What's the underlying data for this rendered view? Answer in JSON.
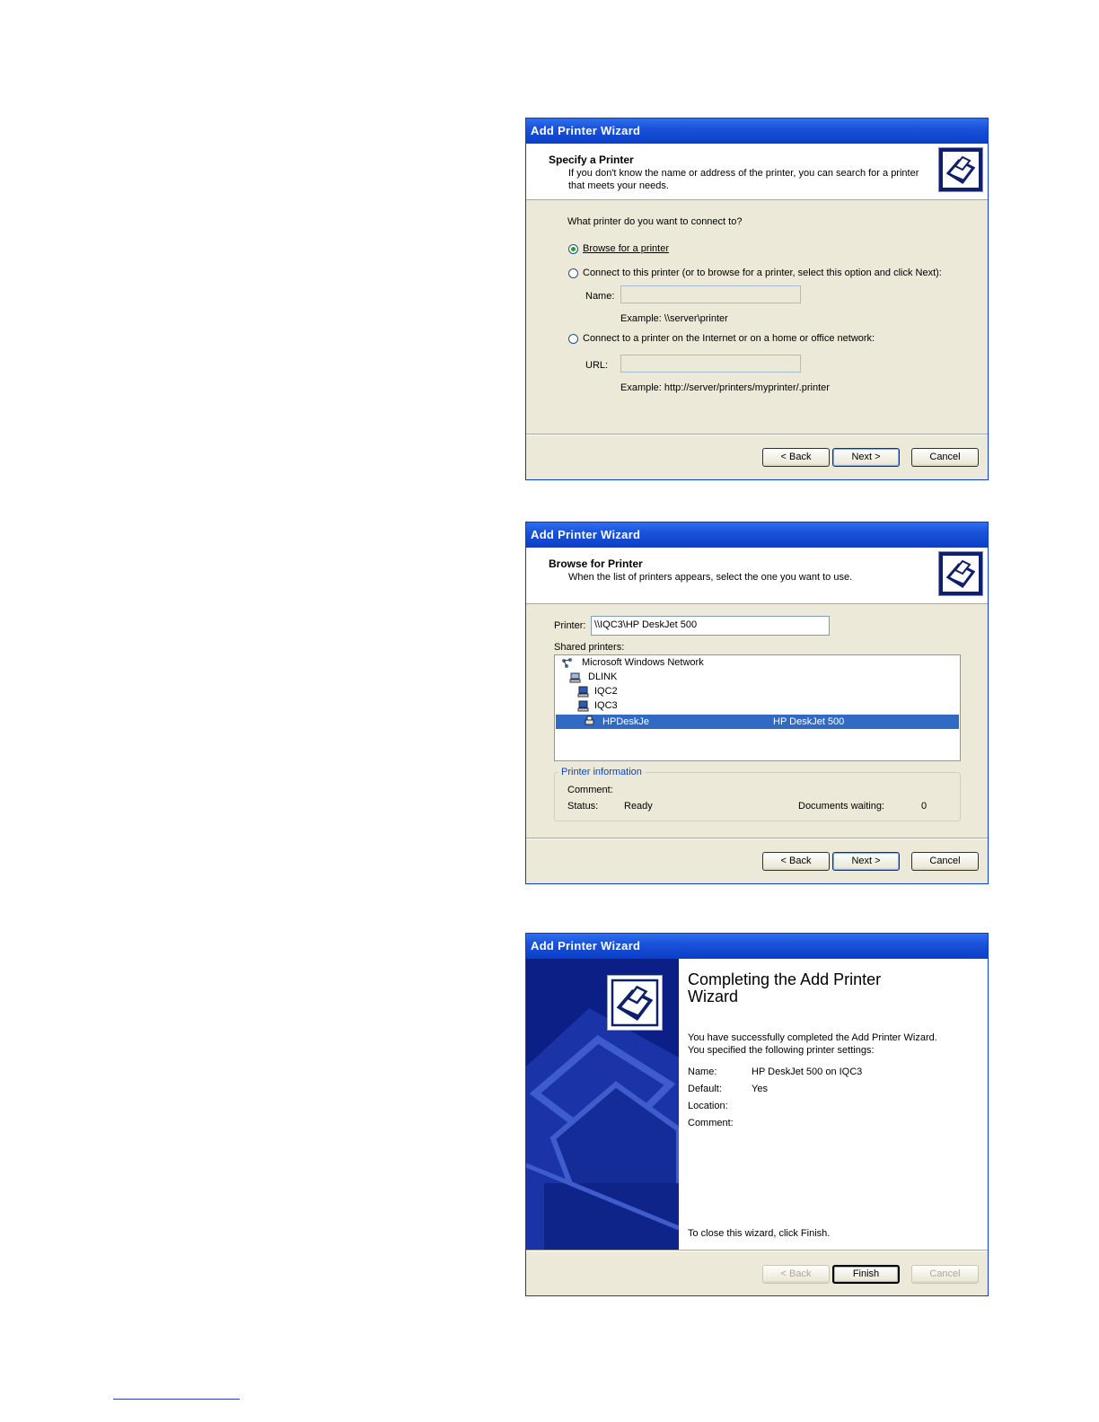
{
  "wizard1": {
    "title": "Add Printer Wizard",
    "header_title": "Specify a Printer",
    "header_desc": "If you don't know the name or address of the printer, you can search for a printer that meets your needs.",
    "question": "What printer do you want to connect to?",
    "option_browse": "Browse for a printer",
    "option_connect": "Connect to this printer (or to browse for a printer, select this option and click Next):",
    "name_label": "Name:",
    "name_value": "",
    "name_example": "Example: \\\\server\\printer",
    "option_internet": "Connect to a printer on the Internet or on a home or office network:",
    "url_label": "URL:",
    "url_value": "",
    "url_example": "Example: http://server/printers/myprinter/.printer",
    "btn_back": "< Back",
    "btn_next": "Next >",
    "btn_cancel": "Cancel"
  },
  "wizard2": {
    "title": "Add Printer Wizard",
    "header_title": "Browse for Printer",
    "header_desc": "When the list of printers appears, select the one you want to use.",
    "printer_label": "Printer:",
    "printer_value": "\\\\IQC3\\HP DeskJet 500",
    "shared_label": "Shared printers:",
    "tree": {
      "network": "Microsoft Windows Network",
      "domain": "DLINK",
      "pc1": "IQC2",
      "pc2": "IQC3",
      "printer_name": "HPDeskJe",
      "printer_model": "HP DeskJet 500"
    },
    "info_group": "Printer information",
    "comment_label": "Comment:",
    "status_label": "Status:",
    "status_value": "Ready",
    "docs_label": "Documents waiting:",
    "docs_value": "0",
    "btn_back": "< Back",
    "btn_next": "Next >",
    "btn_cancel": "Cancel"
  },
  "wizard3": {
    "title": "Add Printer Wizard",
    "heading_line1": "Completing the Add Printer",
    "heading_line2": "Wizard",
    "desc_line1": "You have successfully completed the Add Printer Wizard.",
    "desc_line2": "You specified the following printer settings:",
    "name_label": "Name:",
    "name_value": "HP DeskJet 500 on IQC3",
    "default_label": "Default:",
    "default_value": "Yes",
    "location_label": "Location:",
    "comment_label": "Comment:",
    "close_text": "To close this wizard, click Finish.",
    "btn_back": "< Back",
    "btn_finish": "Finish",
    "btn_cancel": "Cancel"
  }
}
